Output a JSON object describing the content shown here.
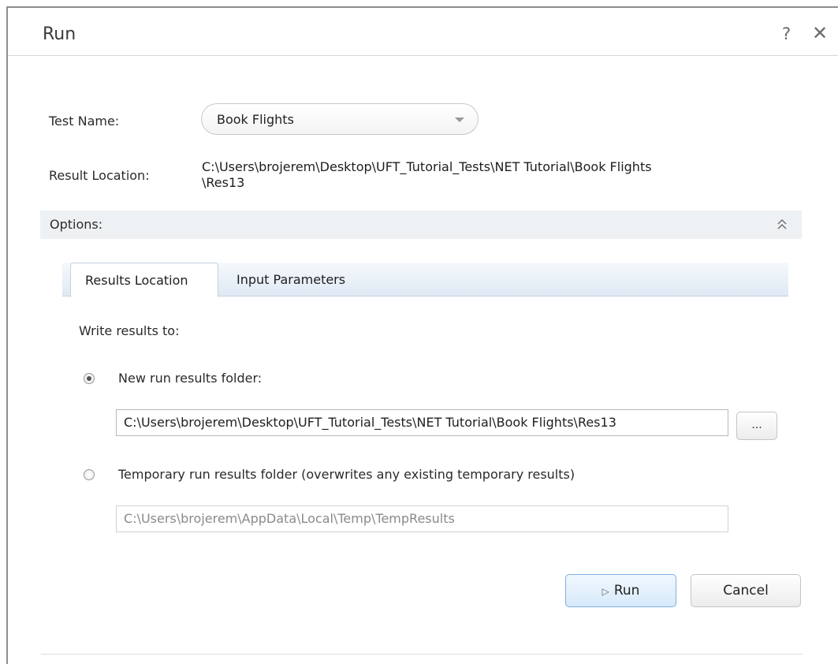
{
  "window": {
    "title": "Run",
    "help_label": "?",
    "close_label": "✕"
  },
  "form": {
    "test_name_label": "Test Name:",
    "test_name_value": "Book Flights",
    "result_location_label": "Result Location:",
    "result_location_line1": "C:\\Users\\brojerem\\Desktop\\UFT_Tutorial_Tests\\NET Tutorial\\Book Flights",
    "result_location_line2": "\\Res13"
  },
  "options": {
    "label": "Options:",
    "chevron": "⌃⌃"
  },
  "tabs": [
    {
      "label": "Results Location",
      "active": true
    },
    {
      "label": "Input Parameters",
      "active": false
    }
  ],
  "results": {
    "write_to_label": "Write results to:",
    "new_folder_label": "New run results folder:",
    "new_folder_path": "C:\\Users\\brojerem\\Desktop\\UFT_Tutorial_Tests\\NET Tutorial\\Book Flights\\Res13",
    "browse_label": "...",
    "temp_folder_label": "Temporary run results folder (overwrites any existing temporary results)",
    "temp_folder_path": "C:\\Users\\brojerem\\AppData\\Local\\Temp\\TempResults",
    "selected": "new"
  },
  "buttons": {
    "run_icon": "▷",
    "run_label": "Run",
    "cancel_label": "Cancel"
  }
}
